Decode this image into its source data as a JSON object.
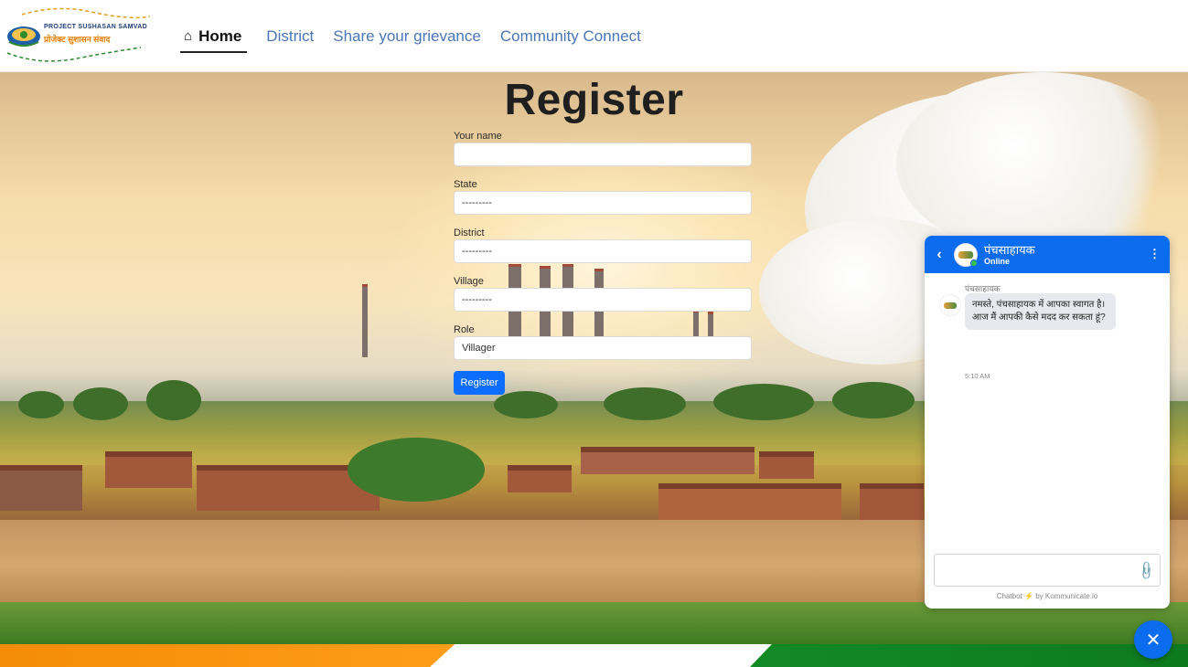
{
  "navbar": {
    "logo": {
      "line1": "PROJECT SUSHASAN SAMVAD",
      "line2": "प्रोजेक्ट सुशासन संवाद"
    },
    "items": [
      {
        "label": "Home",
        "icon": "home-icon",
        "active": true
      },
      {
        "label": "District"
      },
      {
        "label": "Share your grievance"
      },
      {
        "label": "Community Connect"
      }
    ]
  },
  "register": {
    "title": "Register",
    "fields": [
      {
        "label": "Your name",
        "value": ""
      },
      {
        "label": "State",
        "value": "---------"
      },
      {
        "label": "District",
        "value": "---------"
      },
      {
        "label": "Village",
        "value": "---------"
      },
      {
        "label": "Role",
        "value": "Villager"
      }
    ],
    "submit_label": "Register"
  },
  "chat": {
    "title": "पंचसाहायक",
    "status": "Online",
    "message": {
      "sender": "पंचसाहायक",
      "text": "नमस्ते, पंचसाहायक में आपका स्वागत है। आज मैं आपकी कैसे मदद कर सकता हूं?",
      "time": "5:10 AM"
    },
    "footer": {
      "prefix": "Chatbot",
      "suffix": "by Kommunicate.io"
    }
  },
  "colors": {
    "primary": "#0d6efd",
    "chat_header": "#0b6cf0",
    "saffron": "#ff9e1a",
    "green": "#128a25"
  }
}
